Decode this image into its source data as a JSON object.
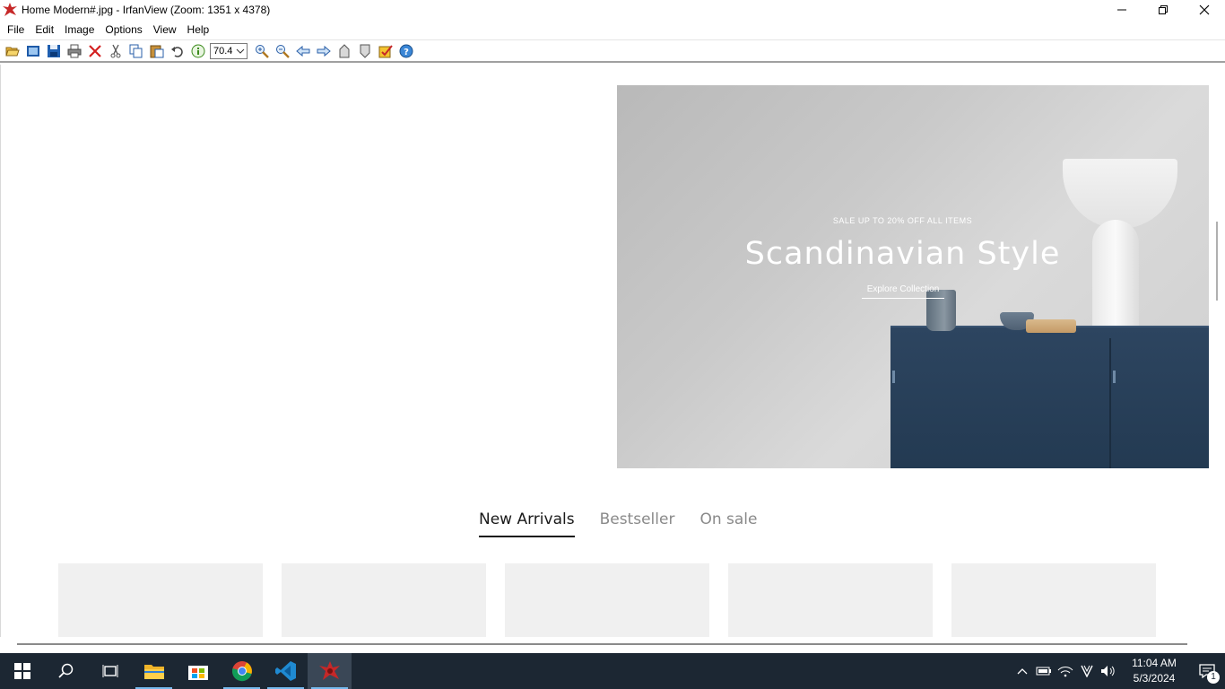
{
  "window": {
    "title": "Home Modern#.jpg - IrfanView (Zoom: 1351 x 4378)",
    "controls": [
      "minimize",
      "maximize",
      "close"
    ]
  },
  "menu": [
    "File",
    "Edit",
    "Image",
    "Options",
    "View",
    "Help"
  ],
  "toolbar": {
    "zoom_value": "70.4",
    "icons": [
      "open-icon",
      "slideshow-icon",
      "save-icon",
      "print-icon",
      "delete-icon",
      "cut-icon",
      "copy-icon",
      "paste-icon",
      "undo-icon",
      "info-icon",
      "zoom-in-icon",
      "zoom-out-icon",
      "previous-icon",
      "next-icon",
      "first-icon",
      "last-icon",
      "properties-icon",
      "help-icon"
    ]
  },
  "image": {
    "hero": {
      "sale_text": "SALE UP TO 20% OFF ALL ITEMS",
      "headline": "Scandinavian Style",
      "cta": "Explore Collection"
    },
    "tabs": [
      {
        "label": "New Arrivals",
        "active": true
      },
      {
        "label": "Bestseller",
        "active": false
      },
      {
        "label": "On sale",
        "active": false
      }
    ],
    "product_cards": 5
  },
  "taskbar": {
    "apps": [
      "start-icon",
      "search-icon",
      "task-view-icon",
      "file-explorer-icon",
      "store-icon",
      "chrome-icon",
      "vscode-icon",
      "irfanview-icon"
    ],
    "active_app": "irfanview-icon",
    "time": "11:04 AM",
    "date": "5/3/2024",
    "notification_count": "1"
  },
  "colors": {
    "taskbar_bg": "#1c2733",
    "accent": "#76b9ed",
    "cabinet": "#2d4560"
  }
}
